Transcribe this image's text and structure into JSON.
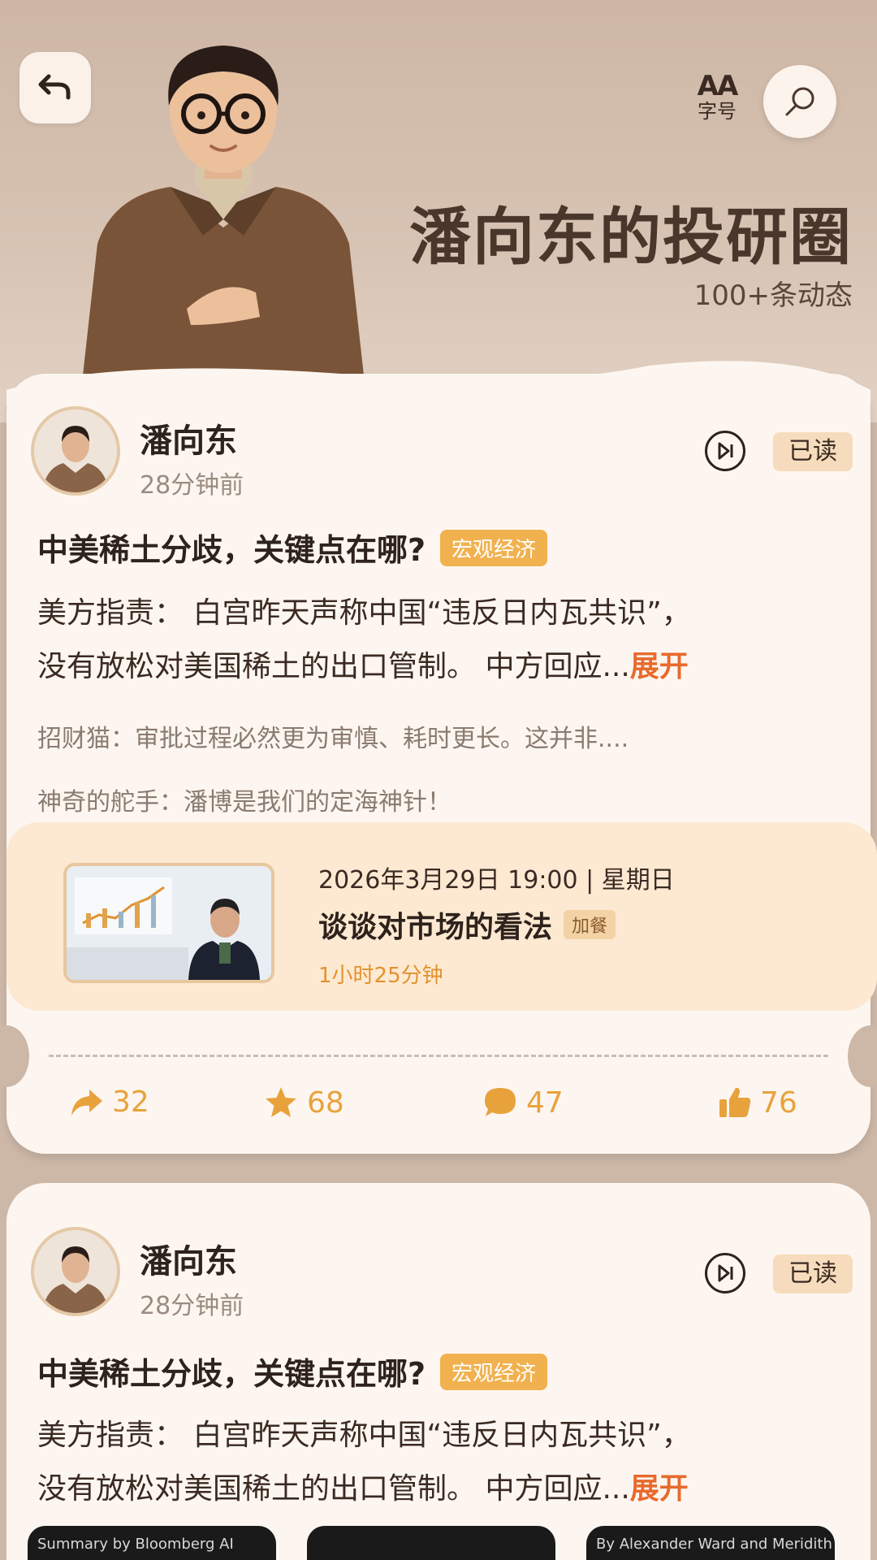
{
  "header": {
    "title": "潘向东的投研圈",
    "subtitle": "100+条动态",
    "font_label": "字号",
    "font_glyph": "AA"
  },
  "posts": [
    {
      "author": "潘向东",
      "time": "28分钟前",
      "read_label": "已读",
      "title": "中美稀土分歧，关键点在哪?",
      "tag": "宏观经济",
      "body_line1": "美方指责： 白宫昨天声称中国“违反日内瓦共识”，",
      "body_line2": "没有放松对美国稀土的出口管制。 中方回应...",
      "expand_label": "展开",
      "comments": [
        "招财猫：审批过程必然更为审慎、耗时更长。这并非....",
        "神奇的舵手：潘博是我们的定海神针！"
      ],
      "live": {
        "date": "2026年3月29日 19:00 | 星期日",
        "title": "谈谈对市场的看法",
        "tag": "加餐",
        "duration": "1小时25分钟"
      },
      "stats": {
        "share": "32",
        "star": "68",
        "comment": "47",
        "like": "76"
      }
    },
    {
      "author": "潘向东",
      "time": "28分钟前",
      "read_label": "已读",
      "title": "中美稀土分歧，关键点在哪?",
      "tag": "宏观经济",
      "body_line1": "美方指责： 白宫昨天声称中国“违反日内瓦共识”，",
      "body_line2": "没有放松对美国稀土的出口管制。 中方回应...",
      "expand_label": "展开"
    }
  ],
  "thumbnails": [
    {
      "caption": "Summary by Bloomberg AI"
    },
    {
      "caption": ""
    },
    {
      "caption": "By Alexander Ward and Meridith M"
    }
  ],
  "colors": {
    "accent_orange": "#f1b14f",
    "expand_red": "#e86a2c",
    "stat_orange": "#e8a23c",
    "card_bg": "#fdf6f0"
  }
}
